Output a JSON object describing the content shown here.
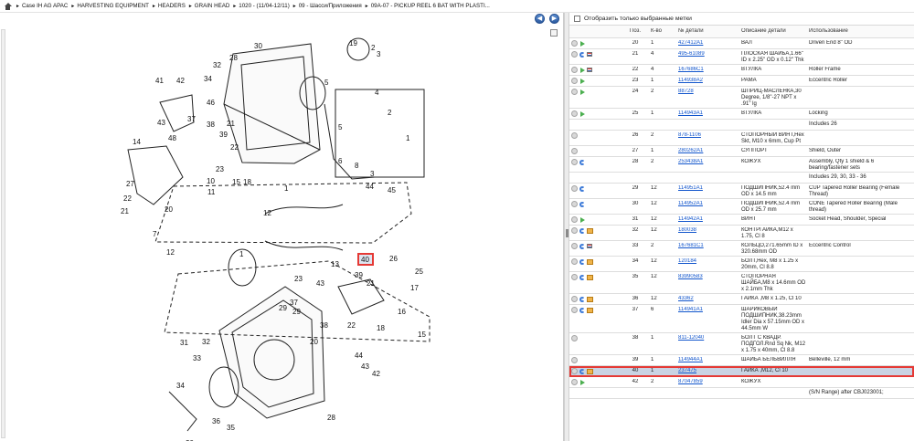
{
  "breadcrumbs": [
    "Case IH AG APAC",
    "HARVESTING EQUIPMENT",
    "HEADERS",
    "GRAIN HEAD",
    "1020 - (11/04-12/11)",
    "09 - Шасси/Приложения",
    "09A-07 - PICKUP REEL 6 BAT WITH PLASTI..."
  ],
  "nav": {
    "back_symbol": "◀",
    "forward_symbol": "▶"
  },
  "filter": {
    "label": "Отобразить только выбранные метки"
  },
  "table": {
    "headers": {
      "pos": "Поз.",
      "qty": "К-во",
      "part": "№ детали",
      "desc": "Описание детали",
      "usage": "Использование"
    },
    "rows": [
      {
        "icons": [
          "circle",
          "arrow"
        ],
        "pos": "20",
        "qty": "1",
        "part": "427412A1",
        "desc": "ВАЛ",
        "usage": "Driven End 8\" OD"
      },
      {
        "icons": [
          "circle",
          "swirl",
          "flag"
        ],
        "pos": "21",
        "qty": "4",
        "part": "495-61089",
        "desc": "ПЛОСКАЯ ШАЙБА,1.66\" ID x 2.25\" OD x 0.12\" Thk",
        "usage": ""
      },
      {
        "icons": [
          "circle",
          "arrow",
          "flag"
        ],
        "pos": "22",
        "qty": "4",
        "part": "167686C1",
        "desc": "ВТУЛКА",
        "usage": "Roller Frame"
      },
      {
        "icons": [
          "circle",
          "arrow"
        ],
        "pos": "23",
        "qty": "1",
        "part": "114938A2",
        "desc": "РАМА",
        "usage": "Eccentric Roller"
      },
      {
        "icons": [
          "circle",
          "arrow"
        ],
        "pos": "24",
        "qty": "2",
        "part": "88728",
        "desc": "ШПРИЦ-МАСЛЕНКА,30 Degree, 1/8\"-27 NPT x .91\" lg",
        "usage": ""
      },
      {
        "icons": [
          "circle",
          "arrow"
        ],
        "pos": "25",
        "qty": "1",
        "part": "114943A1",
        "desc": "ВТУЛКА",
        "usage": "Locking"
      },
      {
        "info": "Includes 26"
      },
      {
        "icons": [
          "circle"
        ],
        "pos": "26",
        "qty": "2",
        "part": "878-1106",
        "desc": "СТОПОРНЫЙ ВИНТ,Hex Skt, M10 x 6mm, Cup Pt",
        "usage": ""
      },
      {
        "icons": [
          "circle"
        ],
        "pos": "27",
        "qty": "1",
        "part": "280262A1",
        "desc": "СУППОРТ",
        "usage": "Shield, Outer"
      },
      {
        "icons": [
          "circle",
          "swirl"
        ],
        "pos": "28",
        "qty": "2",
        "part": "253438A1",
        "desc": "КОЖУХ",
        "usage": "Assembly, Qty 1 shield & 6 bearing/fastener sets"
      },
      {
        "info": "Includes 29, 30, 33 - 36"
      },
      {
        "icons": [
          "circle",
          "swirl"
        ],
        "pos": "29",
        "qty": "12",
        "part": "114951A1",
        "desc": "ПОДШИПНИК,52.4 mm OD x 14.5 mm",
        "usage": "CUP Tapered Roller Bearing (Female Thread)"
      },
      {
        "icons": [
          "circle",
          "swirl"
        ],
        "pos": "30",
        "qty": "12",
        "part": "114952A1",
        "desc": "ПОДШИПНИК,52.4 mm OD x 25.7 mm",
        "usage": "CONE Tapered Roller Bearing (Male thread)"
      },
      {
        "icons": [
          "circle",
          "arrow"
        ],
        "pos": "31",
        "qty": "12",
        "part": "114942A1",
        "desc": "ВИНТ",
        "usage": "Socket Head, Shoulder, Special"
      },
      {
        "icons": [
          "circle",
          "swirl",
          "box"
        ],
        "pos": "32",
        "qty": "12",
        "part": "180038",
        "desc": "КОНТРГАЙКА,M12 x 1.75, Cl 8",
        "usage": ""
      },
      {
        "icons": [
          "circle",
          "swirl",
          "flag"
        ],
        "pos": "33",
        "qty": "2",
        "part": "167681C1",
        "desc": "КОЛЬЦО,271.65mm ID x 320.68mm OD",
        "usage": "Eccentric Control"
      },
      {
        "icons": [
          "circle",
          "swirl",
          "box"
        ],
        "pos": "34",
        "qty": "12",
        "part": "120184",
        "desc": "БОЛТ,Hex, M8 x 1.25 x 20mm, Cl 8.8",
        "usage": ""
      },
      {
        "icons": [
          "circle",
          "swirl",
          "box"
        ],
        "pos": "35",
        "qty": "12",
        "part": "83990583",
        "desc": "СТОПОРНАЯ ШАЙБА,M8 x 14.6mm OD x 2.1mm Thk",
        "usage": ""
      },
      {
        "icons": [
          "circle",
          "swirl",
          "box"
        ],
        "pos": "36",
        "qty": "12",
        "part": "43362",
        "desc": "ГАЙКА ,M8 x 1.25, Cl 10",
        "usage": ""
      },
      {
        "icons": [
          "circle",
          "swirl",
          "box"
        ],
        "pos": "37",
        "qty": "6",
        "part": "114941A1",
        "desc": "ШАРИКОВЫЙ ПОДШИПНИК,38.23mm Idler Dia x 57.15mm OD x 44.5mm W",
        "usage": ""
      },
      {
        "icons": [
          "circle"
        ],
        "pos": "38",
        "qty": "1",
        "part": "811-12040",
        "desc": "БОЛТ С КВАДР. ПОДГОЛ.Rnd Sq Nk, M12 x 1.75 x 40mm, Cl 8.8",
        "usage": ""
      },
      {
        "icons": [
          "circle"
        ],
        "pos": "39",
        "qty": "1",
        "part": "114944A1",
        "desc": "ШАЙБА БЕЛЬВИЛЛЯ",
        "usage": "Belleville, 12 mm"
      },
      {
        "icons": [
          "circle",
          "swirl",
          "box"
        ],
        "pos": "40",
        "qty": "1",
        "part": "237475",
        "desc": "ГАЙКА ,M12, Cl 10",
        "usage": "",
        "selected": true
      },
      {
        "icons": [
          "circle",
          "arrow"
        ],
        "pos": "42",
        "qty": "2",
        "part": "87047859",
        "desc": "КОЖУХ",
        "usage": ""
      },
      {
        "info": "(S/N Range) after CBJ023001;"
      }
    ]
  },
  "diagram": {
    "labels": [
      "19",
      "28",
      "30",
      "32",
      "41",
      "42",
      "34",
      "46",
      "43",
      "37",
      "38",
      "39",
      "3",
      "2",
      "1",
      "5",
      "4",
      "14",
      "22",
      "23",
      "20",
      "9",
      "10",
      "11",
      "21",
      "15",
      "18",
      "13",
      "26",
      "25",
      "17",
      "16",
      "8",
      "7",
      "12",
      "31",
      "29",
      "33",
      "44",
      "6",
      "27",
      "24",
      "36",
      "35"
    ],
    "selected_label": "40"
  }
}
